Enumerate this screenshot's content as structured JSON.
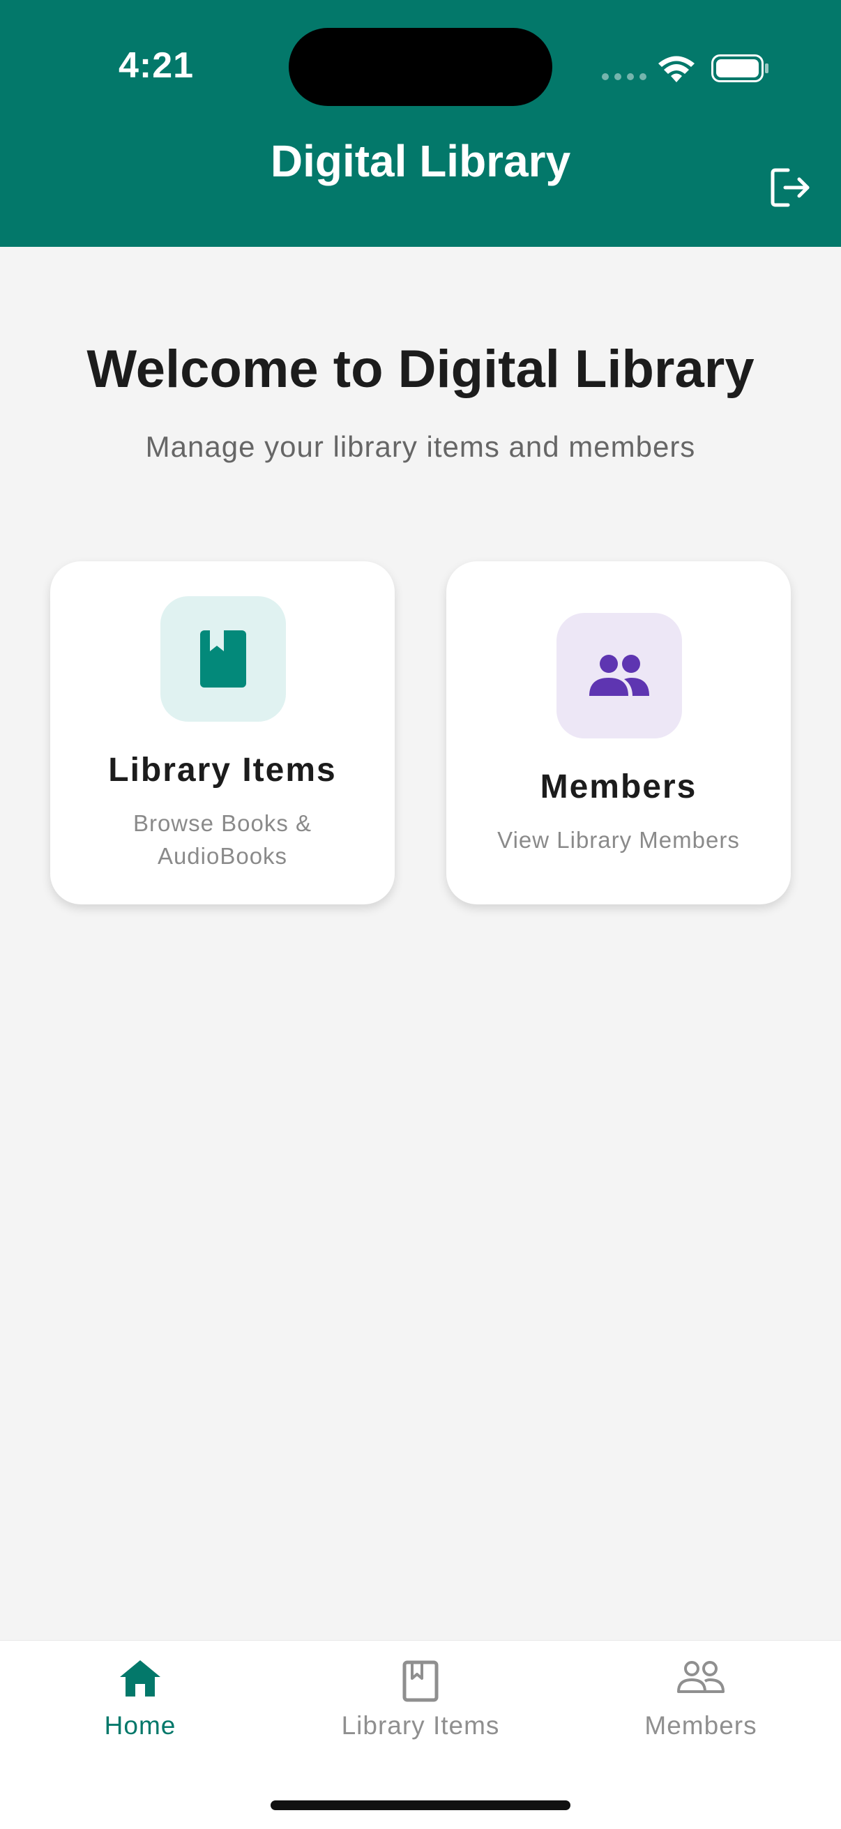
{
  "status_bar": {
    "time": "4:21"
  },
  "app_bar": {
    "title": "Digital Library",
    "logout_icon": "logout-icon"
  },
  "welcome": {
    "title": "Welcome to Digital Library",
    "subtitle": "Manage your library items and members"
  },
  "cards": [
    {
      "title": "Library Items",
      "subtitle": "Browse Books & AudioBooks",
      "icon": "book-icon",
      "accent": "#03897a",
      "icon_bg": "#e0f2f1"
    },
    {
      "title": "Members",
      "subtitle": "View Library Members",
      "icon": "people-icon",
      "accent": "#5e35b1",
      "icon_bg": "#ede7f6"
    }
  ],
  "bottom_nav": [
    {
      "label": "Home",
      "icon": "home-icon",
      "active": true
    },
    {
      "label": "Library Items",
      "icon": "book-outline-icon",
      "active": false
    },
    {
      "label": "Members",
      "icon": "people-outline-icon",
      "active": false
    }
  ],
  "colors": {
    "primary": "#03786a",
    "background": "#f4f4f4"
  }
}
